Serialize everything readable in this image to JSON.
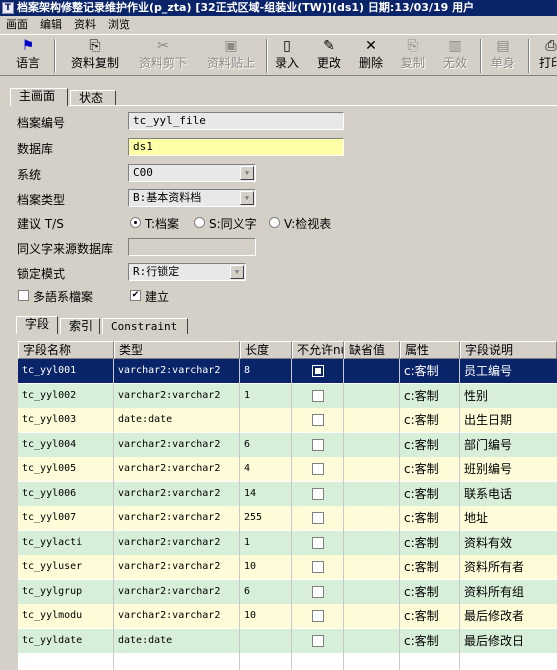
{
  "window": {
    "title": "档案架构修整记录维护作业(p_zta)   [32正式区域-组装业(TW)](ds1)   日期:13/03/19   用户"
  },
  "menu": [
    "画面",
    "编辑",
    "资料",
    "浏览"
  ],
  "toolbar": [
    {
      "label": "语言",
      "icon": "flag-icon",
      "glyph": "⚑",
      "enabled": true
    },
    {
      "label": "资料复制",
      "icon": "copy-data-icon",
      "glyph": "⎘",
      "enabled": true
    },
    {
      "label": "资料剪下",
      "icon": "cut-data-icon",
      "glyph": "✂",
      "enabled": false
    },
    {
      "label": "资料贴上",
      "icon": "paste-data-icon",
      "glyph": "📋",
      "enabled": false
    },
    {
      "label": "录入",
      "icon": "new-document-icon",
      "glyph": "🗋",
      "enabled": true
    },
    {
      "label": "更改",
      "icon": "pencil-icon",
      "glyph": "✎",
      "enabled": true
    },
    {
      "label": "删除",
      "icon": "delete-x-icon",
      "glyph": "✕",
      "enabled": true
    },
    {
      "label": "复制",
      "icon": "copy-icon",
      "glyph": "⎘",
      "enabled": false
    },
    {
      "label": "无效",
      "icon": "trash-icon",
      "glyph": "🗑",
      "enabled": false
    },
    {
      "label": "单身",
      "icon": "detail-icon",
      "glyph": "▤",
      "enabled": false
    },
    {
      "label": "打印",
      "icon": "printer-icon",
      "glyph": "⎙",
      "enabled": true
    }
  ],
  "main_tabs": [
    "主画面",
    "状态"
  ],
  "form": {
    "file_no_label": "档案编号",
    "file_no_value": "tc_yyl_file",
    "database_label": "数据库",
    "database_value": "ds1",
    "system_label": "系统",
    "system_value": "C00",
    "file_type_label": "档案类型",
    "file_type_value": "B:基本资料档",
    "suggest_label": "建议 T/S",
    "radio_options": [
      "T:档案",
      "S:同义字",
      "V:检视表"
    ],
    "radio_selected": 0,
    "synonym_db_label": "同义字来源数据库",
    "synonym_db_value": "",
    "lock_mode_label": "锁定模式",
    "lock_mode_value": "R:行锁定",
    "multi_lang_label": "多語系檔案",
    "multi_lang_checked": false,
    "establish_label": "建立",
    "establish_checked": true
  },
  "detail_tabs": [
    "字段",
    "索引",
    "Constraint"
  ],
  "grid": {
    "columns": [
      "字段名称",
      "类型",
      "长度",
      "不允许nu",
      "缺省值",
      "属性",
      "字段说明"
    ],
    "rows": [
      {
        "name": "tc_yyl001",
        "type": "varchar2:varchar2",
        "len": "8",
        "notnull": true,
        "default": "",
        "attr": "c:客制",
        "desc": "员工编号"
      },
      {
        "name": "tc_yyl002",
        "type": "varchar2:varchar2",
        "len": "1",
        "notnull": false,
        "default": "",
        "attr": "c:客制",
        "desc": "性别"
      },
      {
        "name": "tc_yyl003",
        "type": "date:date",
        "len": "",
        "notnull": false,
        "default": "",
        "attr": "c:客制",
        "desc": "出生日期"
      },
      {
        "name": "tc_yyl004",
        "type": "varchar2:varchar2",
        "len": "6",
        "notnull": false,
        "default": "",
        "attr": "c:客制",
        "desc": "部门编号"
      },
      {
        "name": "tc_yyl005",
        "type": "varchar2:varchar2",
        "len": "4",
        "notnull": false,
        "default": "",
        "attr": "c:客制",
        "desc": "班别编号"
      },
      {
        "name": "tc_yyl006",
        "type": "varchar2:varchar2",
        "len": "14",
        "notnull": false,
        "default": "",
        "attr": "c:客制",
        "desc": "联系电话"
      },
      {
        "name": "tc_yyl007",
        "type": "varchar2:varchar2",
        "len": "255",
        "notnull": false,
        "default": "",
        "attr": "c:客制",
        "desc": "地址"
      },
      {
        "name": "tc_yylacti",
        "type": "varchar2:varchar2",
        "len": "1",
        "notnull": false,
        "default": "",
        "attr": "c:客制",
        "desc": "资料有效"
      },
      {
        "name": "tc_yyluser",
        "type": "varchar2:varchar2",
        "len": "10",
        "notnull": false,
        "default": "",
        "attr": "c:客制",
        "desc": "资料所有者"
      },
      {
        "name": "tc_yylgrup",
        "type": "varchar2:varchar2",
        "len": "6",
        "notnull": false,
        "default": "",
        "attr": "c:客制",
        "desc": "资料所有组"
      },
      {
        "name": "tc_yylmodu",
        "type": "varchar2:varchar2",
        "len": "10",
        "notnull": false,
        "default": "",
        "attr": "c:客制",
        "desc": "最后修改者"
      },
      {
        "name": "tc_yyldate",
        "type": "date:date",
        "len": "",
        "notnull": false,
        "default": "",
        "attr": "c:客制",
        "desc": "最后修改日"
      }
    ],
    "row_colors": [
      "#fdfbd8",
      "#d7eed8"
    ],
    "selected_color": "#0a246a"
  }
}
